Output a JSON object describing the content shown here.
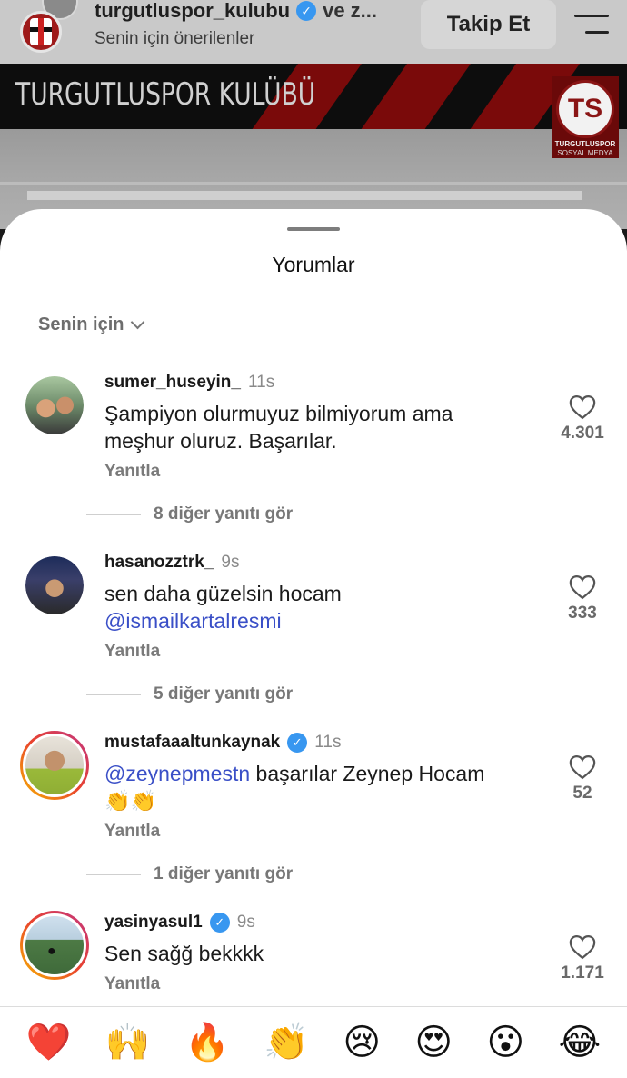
{
  "header": {
    "username": "turgutluspor_kulubu",
    "and_text": "ve z...",
    "subtitle": "Senin için önerilenler",
    "follow_label": "Takip Et"
  },
  "banner": {
    "title": "TURGUTLUSPOR KULÜBÜ",
    "logo_name": "TURGUTLUSPOR",
    "logo_sub": "SOSYAL MEDYA"
  },
  "comments_sheet": {
    "title": "Yorumlar",
    "filter_label": "Senin için",
    "comments": [
      {
        "username": "sumer_huseyin_",
        "time": "11s",
        "verified": false,
        "text_line1": "Şampiyon olurmuyuz bilmiyorum ama",
        "text_line2": "meşhur oluruz. Başarılar.",
        "reply_label": "Yanıtla",
        "likes": "4.301",
        "more_replies": "8 diğer yanıtı gör"
      },
      {
        "username": "hasanozztrk_",
        "time": "9s",
        "verified": false,
        "text_line1": "sen daha güzelsin hocam",
        "mention": "@ismailkartalresmi",
        "reply_label": "Yanıtla",
        "likes": "333",
        "more_replies": "5 diğer yanıtı gör"
      },
      {
        "username": "mustafaaaltunkaynak",
        "time": "11s",
        "verified": true,
        "mention": "@zeynepmestn",
        "text_line1": " başarılar Zeynep Hocam",
        "text_line2": "👏👏",
        "reply_label": "Yanıtla",
        "likes": "52",
        "more_replies": "1 diğer yanıtı gör"
      },
      {
        "username": "yasinyasul1",
        "time": "9s",
        "verified": true,
        "text_line1": "Sen sağğ bekkkk",
        "reply_label": "Yanıtla",
        "likes": "1.171"
      }
    ]
  },
  "reactions": [
    "❤️",
    "🙌",
    "🔥",
    "👏",
    "😢",
    "😍",
    "😮",
    "😂"
  ],
  "colors": {
    "accent_blue": "#3897f0",
    "mention": "#3a4fc7",
    "club_red": "#9e1b1b"
  }
}
